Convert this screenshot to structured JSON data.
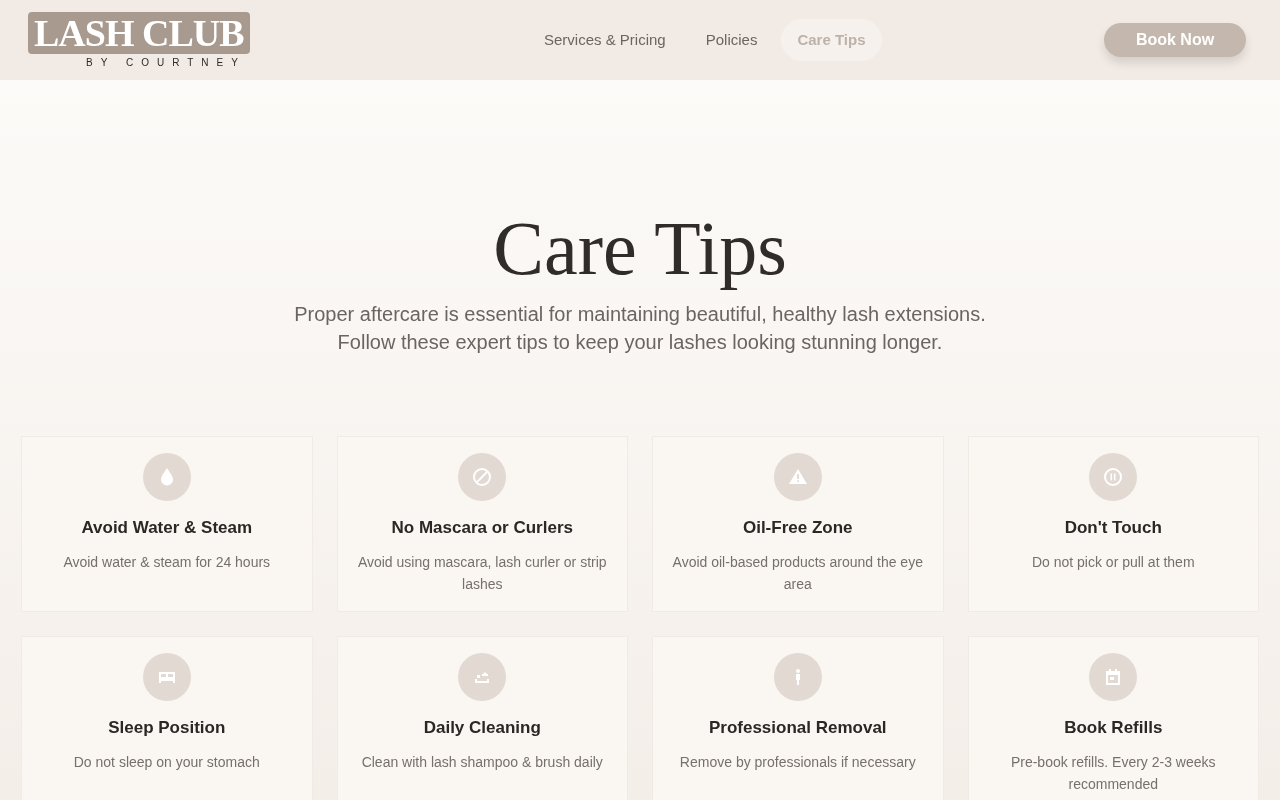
{
  "header": {
    "logo": {
      "wordmark": "LASH CLUB",
      "tagline": "BY COURTNEY"
    },
    "nav": [
      {
        "label": "Services & Pricing",
        "selected": false
      },
      {
        "label": "Policies",
        "selected": false
      },
      {
        "label": "Care Tips",
        "selected": true
      }
    ],
    "cta": "Book Now"
  },
  "hero": {
    "title": "Care Tips",
    "subtitle": [
      "Proper aftercare is essential for maintaining beautiful, healthy lash extensions.",
      "Follow these expert tips to keep your lashes looking stunning longer."
    ]
  },
  "tips": [
    {
      "kind": "drop",
      "title": "Avoid Water & Steam",
      "text": "Avoid water & steam for 24 hours"
    },
    {
      "kind": "ban",
      "title": "No Mascara or Curlers",
      "text": "Avoid using mascara, lash curler or strip lashes"
    },
    {
      "kind": "warning",
      "title": "Oil-Free Zone",
      "text": "Avoid oil-based products around the eye area"
    },
    {
      "kind": "pause",
      "title": "Don't Touch",
      "text": "Do not pick or pull at them"
    },
    {
      "kind": "bed",
      "title": "Sleep Position",
      "text": "Do not sleep on your stomach"
    },
    {
      "kind": "wash",
      "title": "Daily Cleaning",
      "text": "Clean with lash shampoo & brush daily"
    },
    {
      "kind": "person",
      "title": "Professional Removal",
      "text": "Remove by professionals if necessary"
    },
    {
      "kind": "calendar",
      "title": "Book Refills",
      "text": "Pre-book refills. Every 2-3 weeks recommended"
    }
  ]
}
